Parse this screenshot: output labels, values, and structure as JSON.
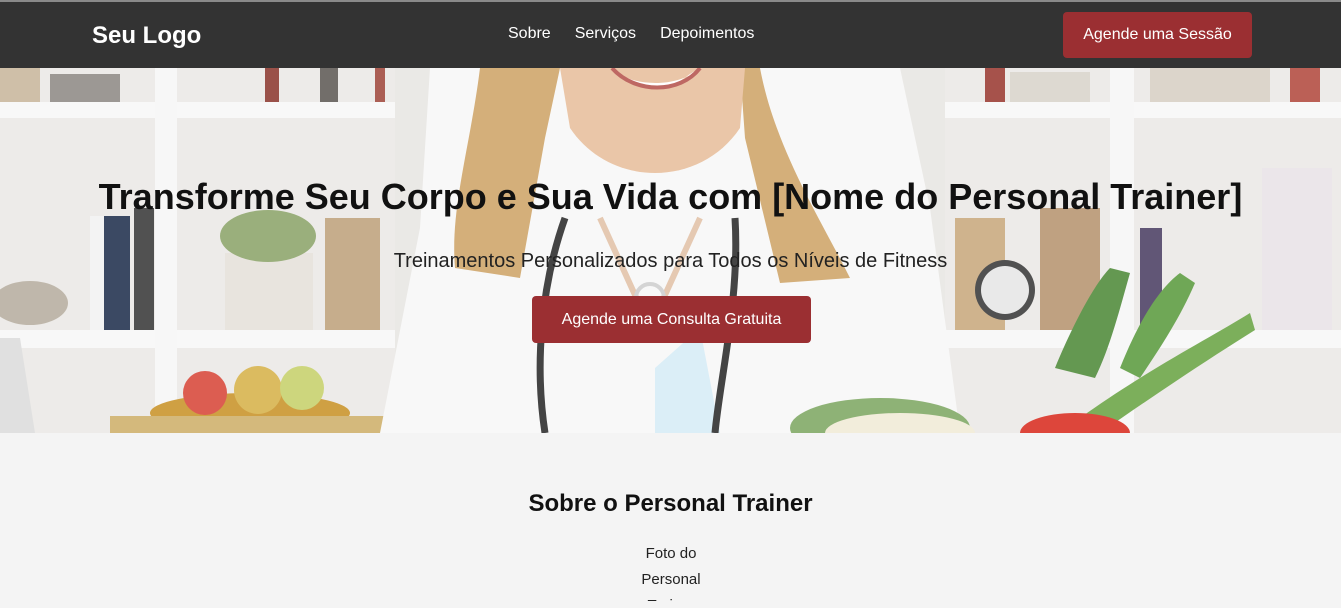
{
  "header": {
    "logo": "Seu Logo",
    "nav": [
      "Sobre",
      "Serviços",
      "Depoimentos"
    ],
    "cta": "Agende uma Sessão"
  },
  "hero": {
    "title": "Transforme Seu Corpo e Sua Vida com [Nome do Personal Trainer]",
    "subtitle": "Treinamentos Personalizados para Todos os Níveis de Fitness",
    "cta": "Agende uma Consulta Gratuita"
  },
  "about": {
    "title": "Sobre o Personal Trainer",
    "photo_alt": "Foto do Personal Trainer"
  },
  "colors": {
    "header_bg": "#333333",
    "accent": "#9b2f32",
    "page_bg": "#f4f4f4"
  }
}
